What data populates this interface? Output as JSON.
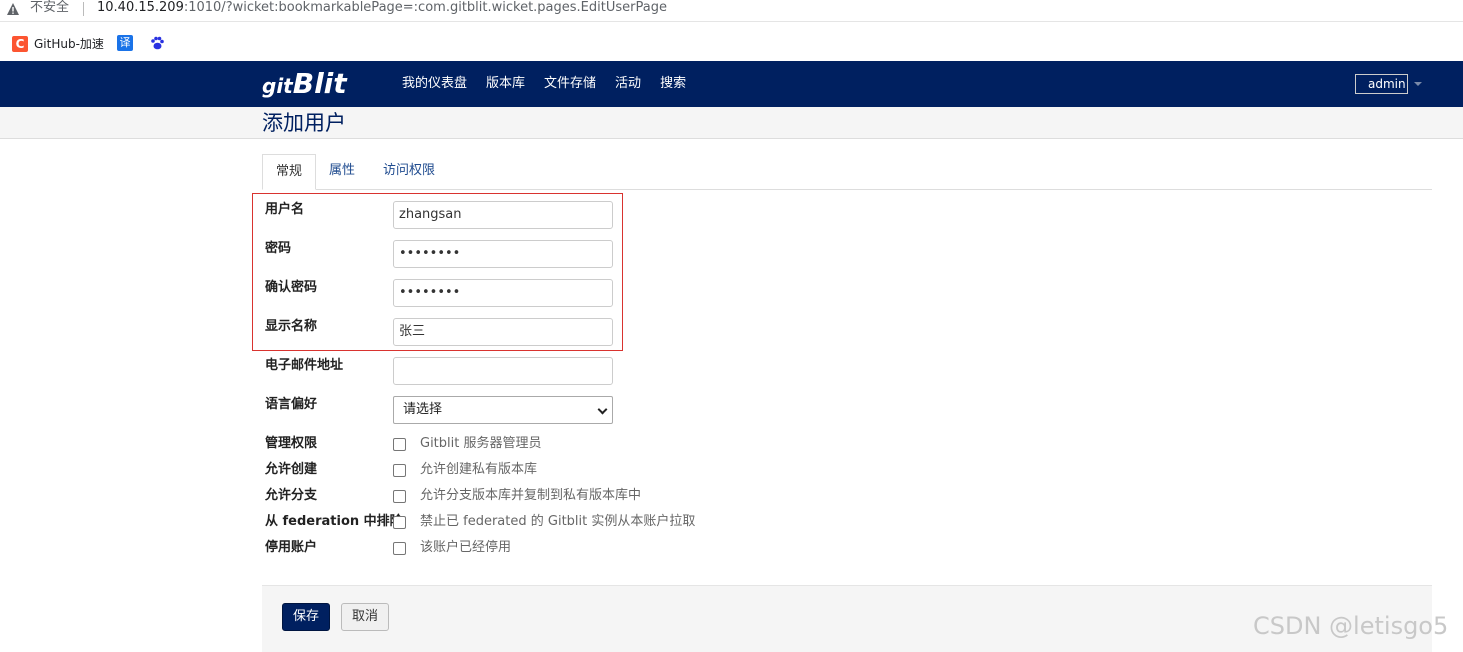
{
  "browser": {
    "security_label": "不安全",
    "url_host": "10.40.15.209",
    "url_rest": ":1010/?wicket:bookmarkablePage=:com.gitblit.wicket.pages.EditUserPage",
    "bookmarks": [
      {
        "icon": "csdn-icon",
        "label": "GitHub-加速"
      },
      {
        "icon": "translate-icon",
        "label": "译"
      },
      {
        "icon": "baidu-paw-icon",
        "label": ""
      }
    ]
  },
  "navbar": {
    "brand_prefix": "git",
    "brand": "Blit",
    "links": [
      "我的仪表盘",
      "版本库",
      "文件存储",
      "活动",
      "搜索"
    ],
    "user": "admin"
  },
  "page": {
    "title": "添加用户"
  },
  "tabs": [
    "常规",
    "属性",
    "访问权限"
  ],
  "form": {
    "username_label": "用户名",
    "username_value": "zhangsan",
    "password_label": "密码",
    "password_value": "••••••••",
    "confirm_label": "确认密码",
    "confirm_value": "••••••••",
    "display_label": "显示名称",
    "display_value": "张三",
    "email_label": "电子邮件地址",
    "email_value": "",
    "locale_label": "语言偏好",
    "locale_value": "请选择",
    "checkboxes": [
      {
        "label": "管理权限",
        "text": "Gitblit 服务器管理员",
        "checked": false
      },
      {
        "label": "允许创建",
        "text": "允许创建私有版本库",
        "checked": false
      },
      {
        "label": "允许分支",
        "text": "允许分支版本库并复制到私有版本库中",
        "checked": false
      },
      {
        "label": "从 federation 中排除",
        "text": "禁止已 federated 的 Gitblit 实例从本账户拉取",
        "checked": false
      },
      {
        "label": "停用账户",
        "text": "该账户已经停用",
        "checked": false
      }
    ]
  },
  "actions": {
    "save": "保存",
    "cancel": "取消"
  },
  "watermark": "CSDN @letisgo5",
  "colors": {
    "navbar": "#002060",
    "highlight": "#d9332f"
  }
}
